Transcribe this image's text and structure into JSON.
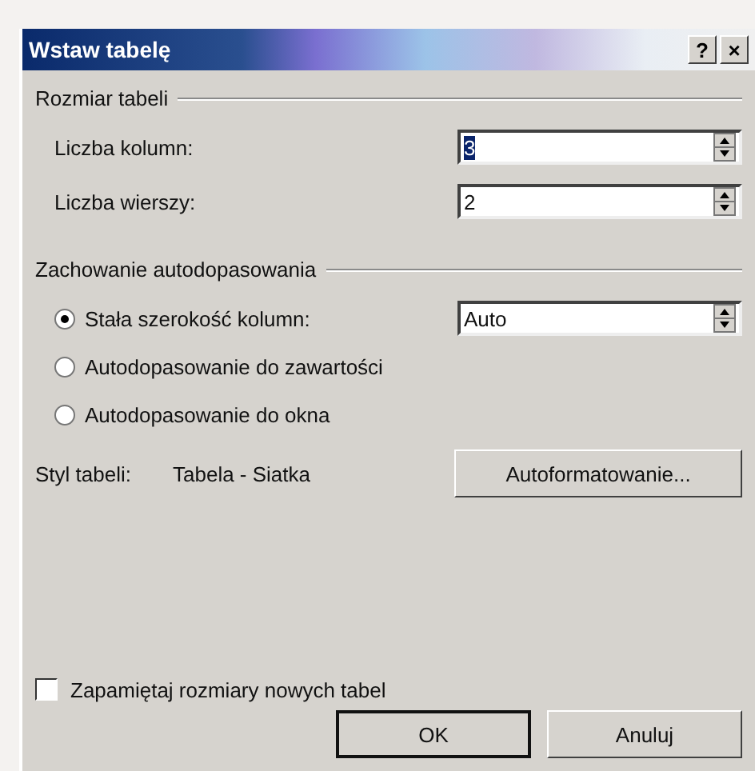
{
  "window": {
    "title": "Wstaw tabelę",
    "buttons": [
      "?",
      "×"
    ]
  },
  "size_group": {
    "label": "Rozmiar tabeli",
    "fields": [
      {
        "label": "Liczba kolumn:",
        "value": "3",
        "text_selected": true
      },
      {
        "label": "Liczba wierszy:",
        "value": "2",
        "text_selected": false
      }
    ]
  },
  "autofit_group": {
    "label": "Zachowanie autodopasowania",
    "options": [
      {
        "label": "Stała szerokość kolumn:",
        "selected": true,
        "value": "Auto"
      },
      {
        "label": "Autodopasowanie do zawartości",
        "selected": false
      },
      {
        "label": "Autodopasowanie do okna",
        "selected": false
      }
    ]
  },
  "table_style": {
    "label": "Styl tabeli:",
    "value": "Tabela - Siatka",
    "button": "Autoformatowanie..."
  },
  "remember": {
    "label": "Zapamiętaj rozmiary nowych tabel",
    "checked": false
  },
  "buttons": [
    {
      "label": "OK",
      "default": true
    },
    {
      "label": "Anuluj",
      "default": false
    }
  ]
}
